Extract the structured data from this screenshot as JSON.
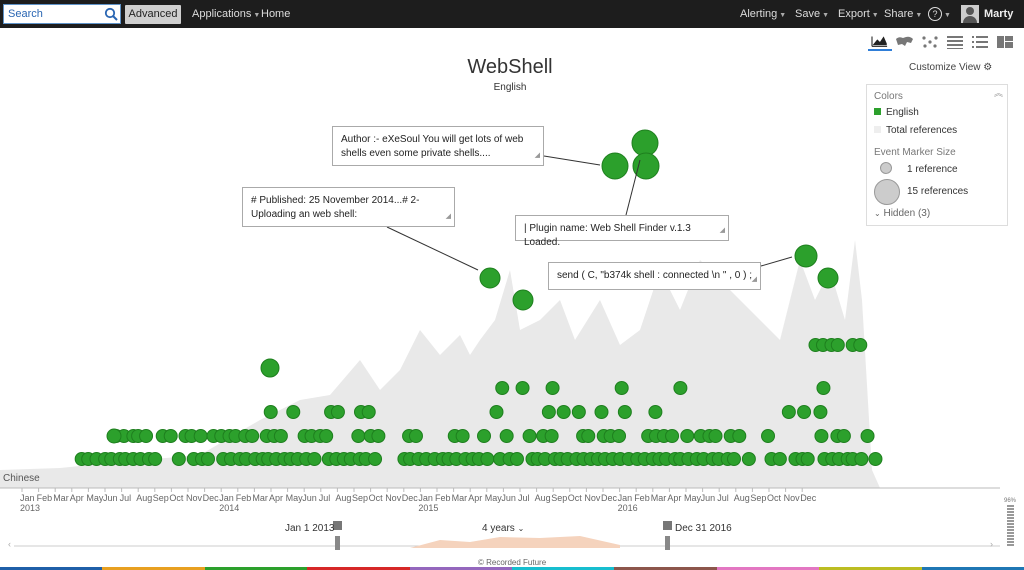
{
  "topbar": {
    "search_placeholder": "Search",
    "advanced_label": "Advanced",
    "applications_label": "Applications",
    "home_label": "Home",
    "alerting_label": "Alerting",
    "save_label": "Save",
    "export_label": "Export",
    "share_label": "Share",
    "help_label": "?",
    "user_name": "Marty"
  },
  "chart_header": {
    "title": "WebShell",
    "subtitle": "English"
  },
  "annotations": [
    "Author :- eXeSoul You will get lots of web shells even some private shells....",
    "# Published: 25 November 2014...# 2- Uploading an web shell:",
    "| Plugin name: Web Shell Finder v.1.3 Loaded.",
    "send ( C, \"b374k shell : connected \\n \" , 0 ) ;"
  ],
  "panel": {
    "customize_label": "Customize View",
    "colors_heading": "Colors",
    "legend_english": "English",
    "legend_total": "Total references",
    "marker_heading": "Event Marker Size",
    "marker_small": "1 reference",
    "marker_large": "15 references",
    "hidden_label": "Hidden (3)"
  },
  "view_icons": [
    "timeline-chart-icon",
    "map-icon",
    "network-icon",
    "table-icon",
    "list-icon",
    "dashboard-icon"
  ],
  "colors": {
    "english": "#2ca02c",
    "english_stroke": "#1e7f1e",
    "total_area": "#e9e9e9",
    "topbar": "#1d1d1d",
    "accent": "#2f7ed8"
  },
  "timeline": {
    "row_label": "Chinese",
    "months": [
      "Jan",
      "Feb",
      "Mar",
      "Apr",
      "May",
      "Jun",
      "Jul",
      "Aug",
      "Sep",
      "Oct",
      "Nov",
      "Dec",
      "Jan",
      "Feb",
      "Mar",
      "Apr",
      "May",
      "Jun",
      "Jul",
      "Aug",
      "Sep",
      "Oct",
      "Nov",
      "Dec",
      "Jan",
      "Feb",
      "Mar",
      "Apr",
      "May",
      "Jun",
      "Jul",
      "Aug",
      "Sep",
      "Oct",
      "Nov",
      "Dec",
      "Jan",
      "Feb",
      "Mar",
      "Apr",
      "May",
      "Jun",
      "Jul",
      "Aug",
      "Sep",
      "Oct",
      "Nov",
      "Dec"
    ],
    "years": [
      "2013",
      "2014",
      "2015",
      "2016"
    ],
    "range_start": "Jan 1 2013",
    "range_end": "Dec 31 2016",
    "range_span": "4 years",
    "zoom_pct": "96%",
    "credit": "© Recorded Future"
  }
}
